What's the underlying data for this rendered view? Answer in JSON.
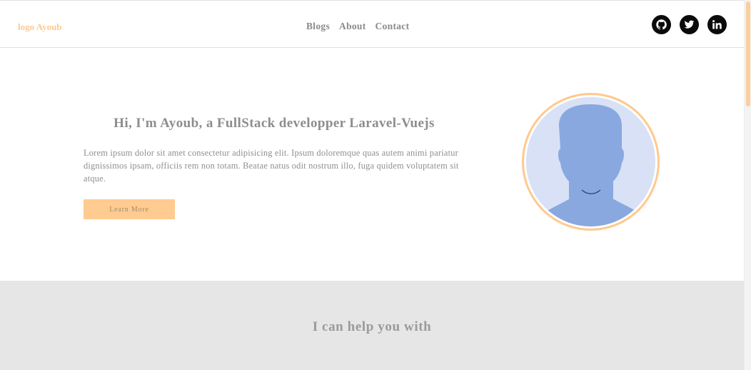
{
  "header": {
    "logo": "logo Ayoub",
    "nav": [
      "Blogs",
      "About",
      "Contact"
    ],
    "socials": [
      "github-icon",
      "twitter-icon",
      "linkedin-icon"
    ]
  },
  "hero": {
    "title": "Hi, I'm Ayoub, a FullStack developper Laravel-Vuejs",
    "text": "Lorem ipsum dolor sit amet consectetur adipisicing elit. Ipsum doloremque quas autem animi pariatur dignissimos ipsam, officiis rem non totam. Beatae natus odit nostrum illo, fuga quidem voluptatem sit atque.",
    "button": "Learn More",
    "avatar": "avatar-placeholder"
  },
  "services": {
    "title": "I can help you with"
  },
  "colors": {
    "accent": "#ffc98e",
    "button": "#ffcb91",
    "text": "#8d8d8d",
    "section_bg": "#e6e6e6",
    "avatar_bg": "#d8e1f5",
    "avatar_figure": "#89a8df"
  }
}
